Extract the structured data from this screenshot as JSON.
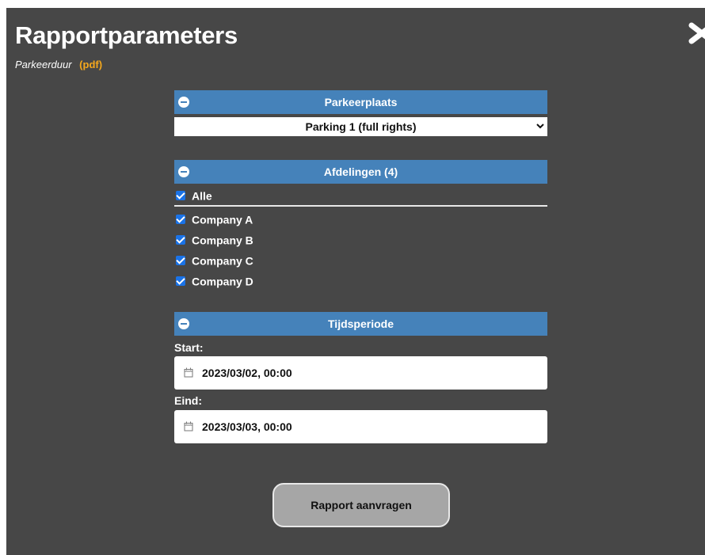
{
  "dialog": {
    "title": "Rapportparameters",
    "report_name": "Parkeerduur",
    "report_format": "(pdf)"
  },
  "parking": {
    "header": "Parkeerplaats",
    "selected": "Parking 1 (full rights)"
  },
  "departments": {
    "header": "Afdelingen (4)",
    "all_label": "Alle",
    "items": [
      "Company A",
      "Company B",
      "Company C",
      "Company D"
    ]
  },
  "period": {
    "header": "Tijdsperiode",
    "start_label": "Start:",
    "start_value": "2023/03/02, 00:00",
    "end_label": "Eind:",
    "end_value": "2023/03/03, 00:00"
  },
  "actions": {
    "submit_label": "Rapport aanvragen"
  },
  "colors": {
    "panel": "#474747",
    "section_header": "#4582ba",
    "format_accent": "#f5a81c",
    "checkbox": "#1a73e8",
    "button": "#a6a6a6"
  },
  "icons": [
    "close-icon",
    "collapse-icon",
    "chevron-down-icon",
    "calendar-icon",
    "checkbox-checked-icon"
  ]
}
